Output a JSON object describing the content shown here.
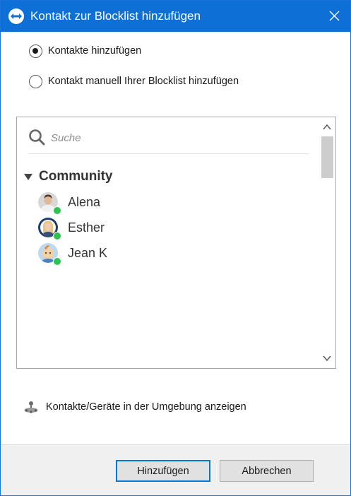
{
  "window": {
    "title": "Kontakt zur Blocklist hinzufügen",
    "brand_color": "#0e6fd6"
  },
  "options": {
    "add_contacts": {
      "label": "Kontakte hinzufügen",
      "checked": true
    },
    "add_manually": {
      "label": "Kontakt manuell Ihrer Blocklist hinzufügen",
      "checked": false
    }
  },
  "search": {
    "placeholder": "Suche",
    "icon": "search-icon"
  },
  "group": {
    "label": "Community",
    "expanded": true,
    "contacts": [
      {
        "name": "Alena",
        "status": "online",
        "avatar": "person-photo"
      },
      {
        "name": "Esther",
        "status": "online",
        "avatar": "person-photo"
      },
      {
        "name": "Jean K",
        "status": "online",
        "avatar": "cartoon-avatar"
      }
    ]
  },
  "nearby": {
    "label": "Kontakte/Geräte in der Umgebung anzeigen",
    "icon": "nearby-devices-icon"
  },
  "buttons": {
    "add": "Hinzufügen",
    "cancel": "Abbrechen"
  },
  "colors": {
    "online": "#2ec24e",
    "primary_border": "#0078d7"
  }
}
